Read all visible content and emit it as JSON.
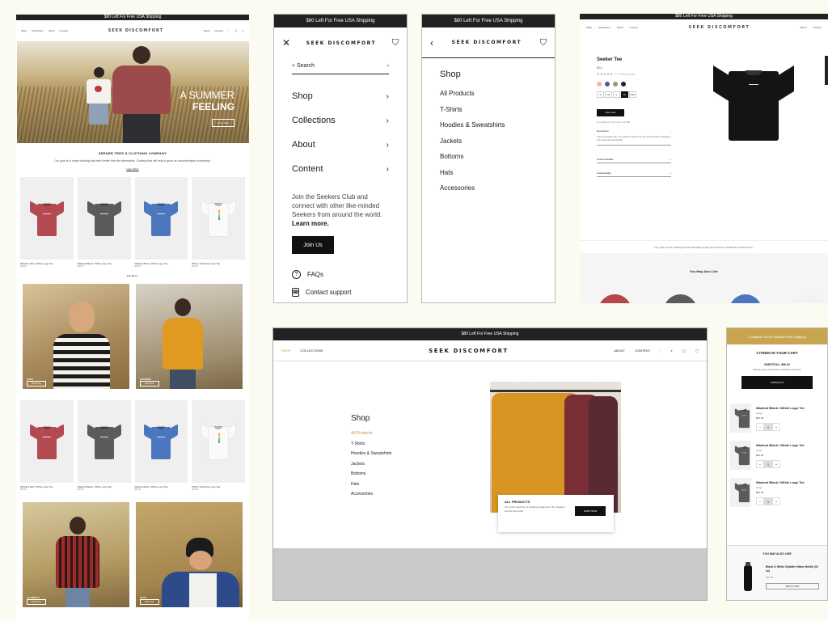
{
  "home": {
    "announcement": "$80 Left For Free USA Shipping",
    "nav_left": [
      "Shop",
      "Collections",
      "About",
      "Content"
    ],
    "logo": "SEEK DISCOMFORT",
    "nav_right": [
      "About",
      "Content"
    ],
    "hero_line1": "A SUMMER",
    "hero_line2": "FEELING",
    "hero_button": "Shop Now",
    "intro_heading": "SEEKER TEES & CLOTHING COMPANY",
    "intro_text": "Our goal is to make clothing that feels better than the alternative. Clothing that will help to grow an uncomfortable community.",
    "intro_link": "Learn More",
    "products_row1": [
      {
        "name": "Washed Red / White Logo Tee",
        "price": "$30.00",
        "color": "red"
      },
      {
        "name": "Washed Black / White Logo Tee",
        "price": "$30.00",
        "color": "gray"
      },
      {
        "name": "Washed Blue / White Logo Tee",
        "price": "$30.00",
        "color": "blue"
      },
      {
        "name": "White / Rainbow Logo Tee",
        "price": "$30.00",
        "color": "white"
      }
    ],
    "see_more": "See More",
    "feature1": {
      "caption": "TEES",
      "button": "Shop Now"
    },
    "feature2": {
      "caption": "HOODIES",
      "button": "Shop Now"
    },
    "products_row2": [
      {
        "name": "Washed Red / White Logo Tee",
        "price": "$30.00",
        "color": "red"
      },
      {
        "name": "Washed Black / White Logo Tee",
        "price": "$30.00",
        "color": "gray"
      },
      {
        "name": "Washed Blue / White Logo Tee",
        "price": "$30.00",
        "color": "blue"
      },
      {
        "name": "White / Rainbow Logo Tee",
        "price": "$30.00",
        "color": "white"
      }
    ],
    "feature3": {
      "caption": "FLANNELS",
      "button": "Shop Now"
    },
    "feature4": {
      "caption": "HATS",
      "button": "Shop Now"
    }
  },
  "mobile_menu": {
    "announcement": "$80 Left For Free USA Shipping",
    "logo": "SEEK DISCOMFORT",
    "search_placeholder": "Search",
    "items": [
      "Shop",
      "Collections",
      "About",
      "Content"
    ],
    "club_text": "Join the Seekers Club and connect with other like-minded Seekers from around the world.",
    "club_more": "Learn more.",
    "join_button": "Join Us",
    "faqs": "FAQs",
    "support": "Contact support"
  },
  "shop_menu": {
    "announcement": "$80 Left For Free USA Shipping",
    "logo": "SEEK DISCOMFORT",
    "title": "Shop",
    "items": [
      "All Products",
      "T-Shirts",
      "Hoodies & Sweatshirts",
      "Jackets",
      "Bottoms",
      "Hats",
      "Accessories"
    ]
  },
  "product": {
    "announcement": "$80 Left For Free USA Shipping",
    "logo": "SEEK DISCOMFORT",
    "nav_left": [
      "Shop",
      "Collections",
      "About",
      "Content"
    ],
    "nav_right": [
      "About",
      "Content"
    ],
    "title": "Seeker Tee",
    "price": "$32",
    "rating": "★★★★★ 72 Reviews",
    "swatches": [
      "#e9b5b8",
      "#4b5c8a",
      "#8f9c7a",
      "#222222"
    ],
    "sizes": [
      "S",
      "M",
      "L",
      "XL",
      "2XL"
    ],
    "selected_size": "XL",
    "add_to_cart": "Add to Cart",
    "shipping_note": "Free shipping on US orders over $80",
    "description_label": "Description",
    "description_text": "This is our Seeker Tee. It is a garment made to be worn by the Seekers. Designed to be simple and comfortable.",
    "details_label": "Product Details",
    "sustain_label": "Sustainability",
    "tagline": "Our goal is to be a lifestyle brand that helps people grow and live outside their comfort zone.",
    "also_like": "You May Also Like",
    "related_colors": [
      "#b5474c",
      "#5b5b5b",
      "#4c77be",
      "#f2f2f2"
    ]
  },
  "desktop_menu": {
    "announcement": "$80 Left For Free USA Shipping",
    "nav_left": [
      "SHOP",
      "COLLECTIONS"
    ],
    "logo": "SEEK DISCOMFORT",
    "nav_right": [
      "ABOUT",
      "CONTENT"
    ],
    "shop_title": "Shop",
    "items": [
      "All Products",
      "T-Shirts",
      "Hoodies & Sweatshirts",
      "Jackets",
      "Bottoms",
      "Hats",
      "Accessories"
    ],
    "card_title": "ALL PRODUCTS",
    "card_text": "Our entire selection of clothing designed for the Seekers around the world.",
    "card_button": "SHOP NOW"
  },
  "cart": {
    "banner": "Congrats! You've unlocked free shipping",
    "title": "3 ITEMS IN YOUR CART",
    "subtotal": "SUBTOTAL: $96.00",
    "note": "Shipping, taxes, and discounts calculated at checkout.",
    "checkout": "CHECKOUT",
    "items": [
      {
        "name": "Washed Black / White Logo Tee",
        "size": "Large",
        "price": "$32.00",
        "qty": "1"
      },
      {
        "name": "Washed Black / White Logo Tee",
        "size": "Large",
        "price": "$32.00",
        "qty": "1"
      },
      {
        "name": "Washed Black / White Logo Tee",
        "size": "Large",
        "price": "$32.00",
        "qty": "1"
      }
    ],
    "upsell_title": "YOU MAY ALSO LIKE",
    "upsell_name": "Black & White Splatter Water Bottle (32 oz)",
    "upsell_price": "$30.00",
    "upsell_button": "ADD TO CART"
  }
}
